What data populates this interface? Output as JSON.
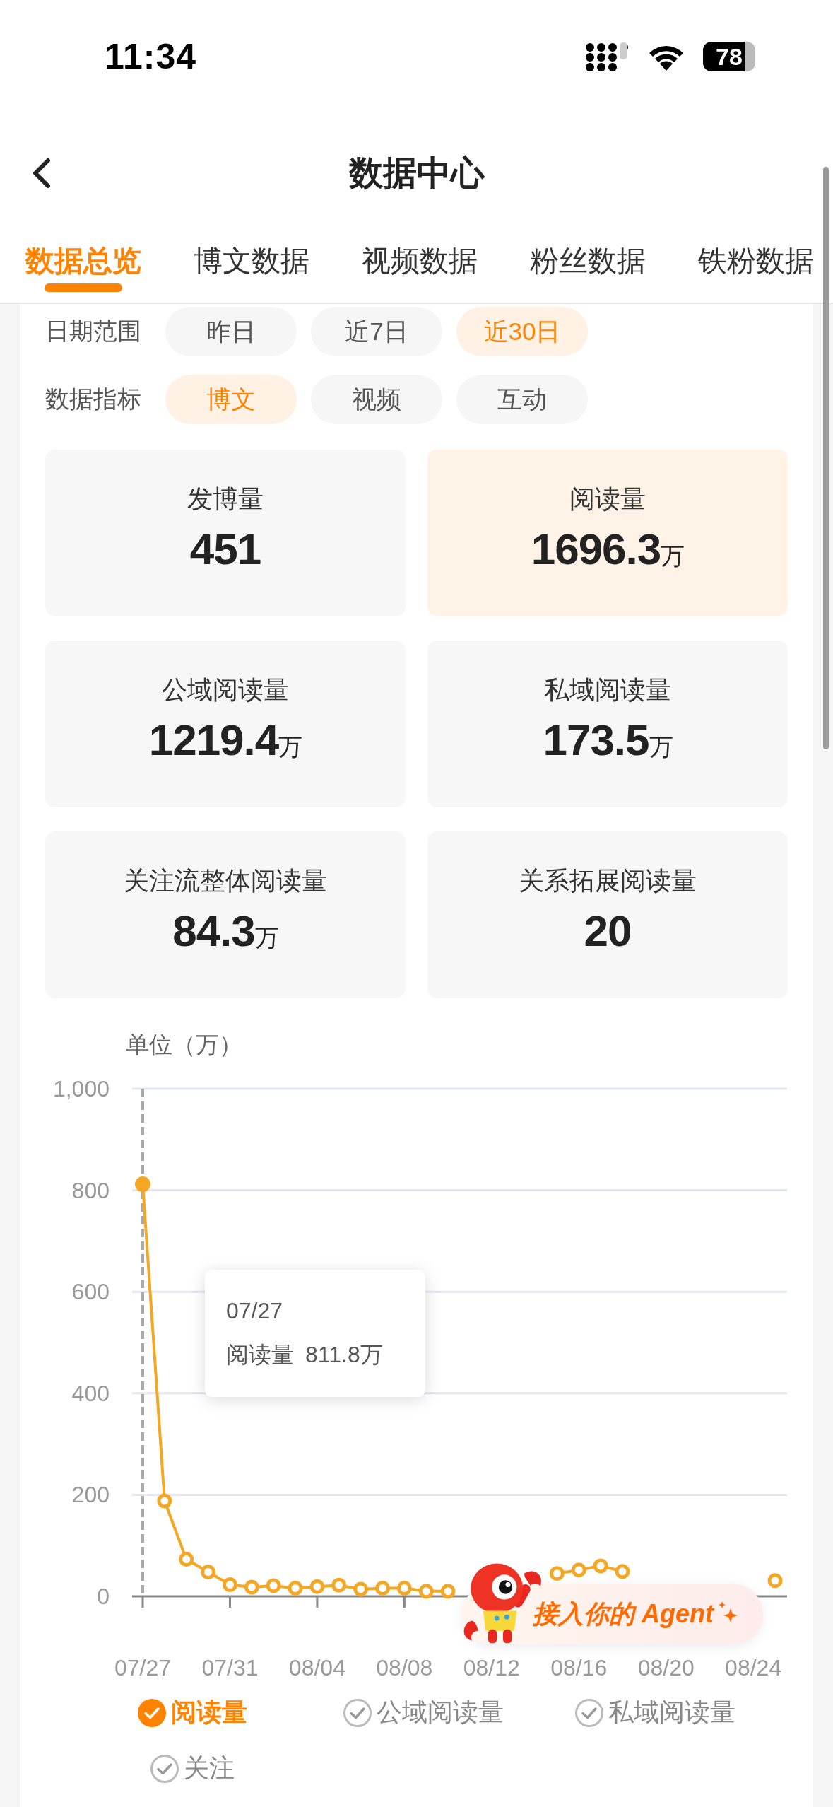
{
  "status_bar": {
    "time": "11:34",
    "battery": "78"
  },
  "nav": {
    "title": "数据中心"
  },
  "tabs": [
    {
      "label": "数据总览",
      "selected": true
    },
    {
      "label": "博文数据",
      "selected": false
    },
    {
      "label": "视频数据",
      "selected": false
    },
    {
      "label": "粉丝数据",
      "selected": false
    },
    {
      "label": "铁粉数据",
      "selected": false
    }
  ],
  "filters": [
    {
      "label": "日期范围",
      "options": [
        {
          "label": "昨日",
          "selected": false
        },
        {
          "label": "近7日",
          "selected": false
        },
        {
          "label": "近30日",
          "selected": true
        }
      ]
    },
    {
      "label": "数据指标",
      "options": [
        {
          "label": "博文",
          "selected": true
        },
        {
          "label": "视频",
          "selected": false
        },
        {
          "label": "互动",
          "selected": false
        }
      ]
    }
  ],
  "stats": [
    {
      "label": "发博量",
      "value": "451",
      "selected": false
    },
    {
      "label": "阅读量",
      "value": "1696.3",
      "unit": "万",
      "selected": true
    },
    {
      "label": "公域阅读量",
      "value": "1219.4",
      "unit": "万",
      "selected": false
    },
    {
      "label": "私域阅读量",
      "value": "173.5",
      "unit": "万",
      "selected": false
    },
    {
      "label": "关注流整体阅读量",
      "value": "84.3",
      "unit": "万",
      "selected": false
    },
    {
      "label": "关系拓展阅读量",
      "value": "20",
      "selected": false
    }
  ],
  "chart": {
    "unit_label": "单位（万）",
    "tooltip": {
      "date": "07/27",
      "value": "811.8万"
    },
    "chart_data": {
      "type": "line",
      "grid": true,
      "categories": [
        "07/27",
        null,
        null,
        null,
        "07/31",
        null,
        null,
        null,
        "08/04",
        null,
        null,
        null,
        "08/08",
        null,
        null,
        null,
        "08/12",
        null,
        null,
        null,
        "08/16",
        null,
        null,
        null,
        "08/20",
        null,
        null,
        null,
        "08/24",
        null
      ],
      "series": [
        {
          "name": "阅读量",
          "color": "#f5a623",
          "marker": "circle",
          "values": [
            812,
            188,
            73,
            48,
            23,
            18,
            21,
            16,
            19,
            22,
            14,
            16,
            16,
            10,
            10,
            null,
            null,
            null,
            null,
            45,
            52,
            60,
            49,
            null,
            null,
            null,
            null,
            null,
            null,
            31
          ]
        }
      ],
      "ylim": [
        0,
        1000
      ],
      "yticks": [
        0,
        200,
        400,
        600,
        800,
        {
          "value": 1000,
          "label": "1,000"
        }
      ]
    },
    "legend": [
      {
        "label": "阅读量",
        "checked": true
      },
      {
        "label": "公域阅读量",
        "checked": false
      },
      {
        "label": "私域阅读量",
        "checked": false
      },
      {
        "label": "关注",
        "checked": false
      }
    ]
  },
  "agent_badge": {
    "label": "接入你的 Agent"
  }
}
